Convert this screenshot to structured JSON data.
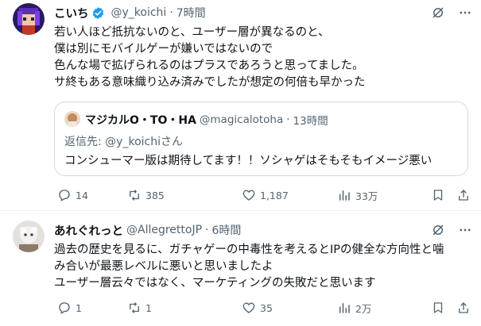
{
  "tweets": [
    {
      "display_name": "こいち",
      "handle": "@y_koichi",
      "time": "7時間",
      "verified": true,
      "body_lines": [
        "若い人ほど抵抗ないのと、ユーザー層が異なるのと、",
        "僕は別にモバイルゲーが嫌いではないので",
        "色んな場で拡げられるのはプラスであろうと思ってました。",
        "サ終もある意味織り込み済みでしたが想定の何倍も早かった"
      ],
      "quote": {
        "display_name": "マジカルO・TO・HA",
        "handle": "@magicalotoha",
        "time": "13時間",
        "reply_prefix": "返信先: ",
        "reply_to": "@y_koichi",
        "reply_suffix": "さん",
        "text": "コンシューマー版は期待してます！！ソシャゲはそもそもイメージ悪い"
      },
      "stats": {
        "replies": "14",
        "retweets": "385",
        "likes": "1,187",
        "views": "33万"
      }
    },
    {
      "display_name": "あれぐれっと",
      "handle": "@AllegrettoJP",
      "time": "6時間",
      "verified": false,
      "body_lines": [
        "過去の歴史を見るに、ガチャゲーの中毒性を考えるとIPの健全な方向性と噛",
        "み合いが最悪レベルに悪いと思いましたよ",
        "ユーザー層云々ではなく、マーケティングの失敗だと思います"
      ],
      "stats": {
        "replies": "1",
        "retweets": "1",
        "likes": "35",
        "views": "2万"
      }
    }
  ],
  "colors": {
    "text": "#0f1419",
    "secondary": "#536471",
    "border": "#cfd9de",
    "divider": "#eff3f4",
    "verified": "#1d9bf0"
  },
  "icons": [
    "grok-icon",
    "more-icon",
    "reply-icon",
    "retweet-icon",
    "like-icon",
    "views-icon",
    "bookmark-icon",
    "share-icon",
    "verified-badge-icon"
  ]
}
